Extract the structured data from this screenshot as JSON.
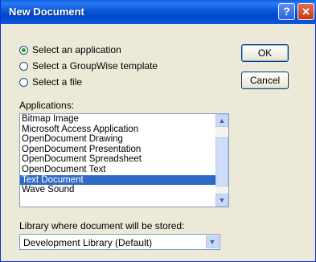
{
  "window": {
    "title": "New Document",
    "help_glyph": "?",
    "close_glyph": "✕"
  },
  "radios": [
    {
      "label": "Select an application",
      "checked": true
    },
    {
      "label": "Select a GroupWise template",
      "checked": false
    },
    {
      "label": "Select a file",
      "checked": false
    }
  ],
  "buttons": {
    "ok": "OK",
    "cancel": "Cancel"
  },
  "applications": {
    "label": "Applications:",
    "items": [
      "Bitmap Image",
      "Microsoft Access Application",
      "OpenDocument Drawing",
      "OpenDocument Presentation",
      "OpenDocument Spreadsheet",
      "OpenDocument Text",
      "Text Document",
      "Wave Sound"
    ],
    "selected": "Text Document"
  },
  "library": {
    "label": "Library where document will be stored:",
    "value": "Development Library  (Default)"
  },
  "icons": {
    "scroll_up": "▲",
    "scroll_down": "▼",
    "combo_arrow": "▼"
  }
}
